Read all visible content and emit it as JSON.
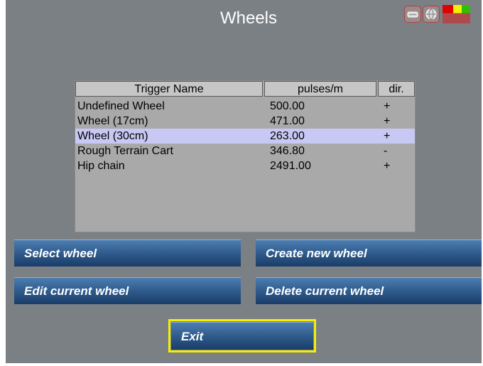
{
  "window": {
    "title": "Wheels"
  },
  "colors": {
    "selected_row": "#c8c8f4",
    "button": "#2f5b8c",
    "exit_highlight": "#f4f000"
  },
  "status": {
    "icons": [
      "hdd-icon",
      "globe-icon"
    ],
    "signal_levels": [
      "red",
      "red",
      "red",
      "red",
      "red",
      "yellow",
      "yellow",
      "yellow",
      "yellow",
      "green",
      "green",
      "green",
      "green"
    ]
  },
  "table": {
    "headers": [
      "Trigger Name",
      "pulses/m",
      "dir."
    ],
    "rows": [
      {
        "name": "Undefined Wheel",
        "pulses": "500.00",
        "dir": "+"
      },
      {
        "name": "Wheel (17cm)",
        "pulses": "471.00",
        "dir": "+"
      },
      {
        "name": "Wheel (30cm)",
        "pulses": "263.00",
        "dir": "+"
      },
      {
        "name": "Rough Terrain Cart",
        "pulses": "346.80",
        "dir": "-"
      },
      {
        "name": "Hip chain",
        "pulses": "2491.00",
        "dir": "+"
      }
    ],
    "selected_index": 2
  },
  "buttons": {
    "select": "Select wheel",
    "create": "Create new wheel",
    "edit": "Edit current wheel",
    "delete": "Delete current wheel",
    "exit": "Exit"
  }
}
